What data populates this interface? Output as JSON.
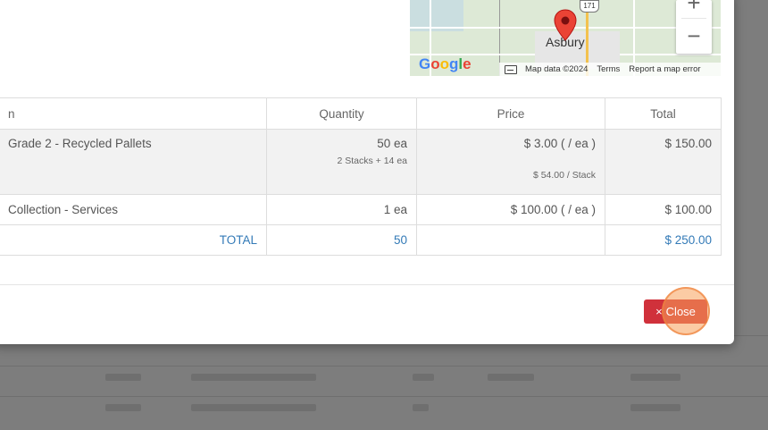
{
  "map": {
    "town_label": "Asbury",
    "route_number": "171",
    "google_logo": "Google",
    "footer": {
      "map_data": "Map data ©2024",
      "terms": "Terms",
      "report": "Report a map error"
    },
    "zoom_in": "+",
    "zoom_out": "−"
  },
  "table": {
    "headers": {
      "item": "n",
      "quantity": "Quantity",
      "price": "Price",
      "total": "Total"
    },
    "rows": [
      {
        "item": "Grade 2 - Recycled Pallets",
        "quantity": "50 ea",
        "quantity_sub": "2 Stacks + 14 ea",
        "price": "$ 3.00 ( / ea )",
        "price_sub": "$ 54.00 / Stack",
        "total": "$ 150.00"
      },
      {
        "item": "Collection - Services",
        "quantity": "1 ea",
        "price": "$ 100.00 ( / ea )",
        "total": "$ 100.00"
      }
    ],
    "footer": {
      "label": "TOTAL",
      "quantity": "50",
      "total": "$ 250.00"
    }
  },
  "buttons": {
    "close_icon": "×",
    "close_label": "Close"
  },
  "colors": {
    "close_button": "#d0313b",
    "total_text": "#337ab7"
  }
}
